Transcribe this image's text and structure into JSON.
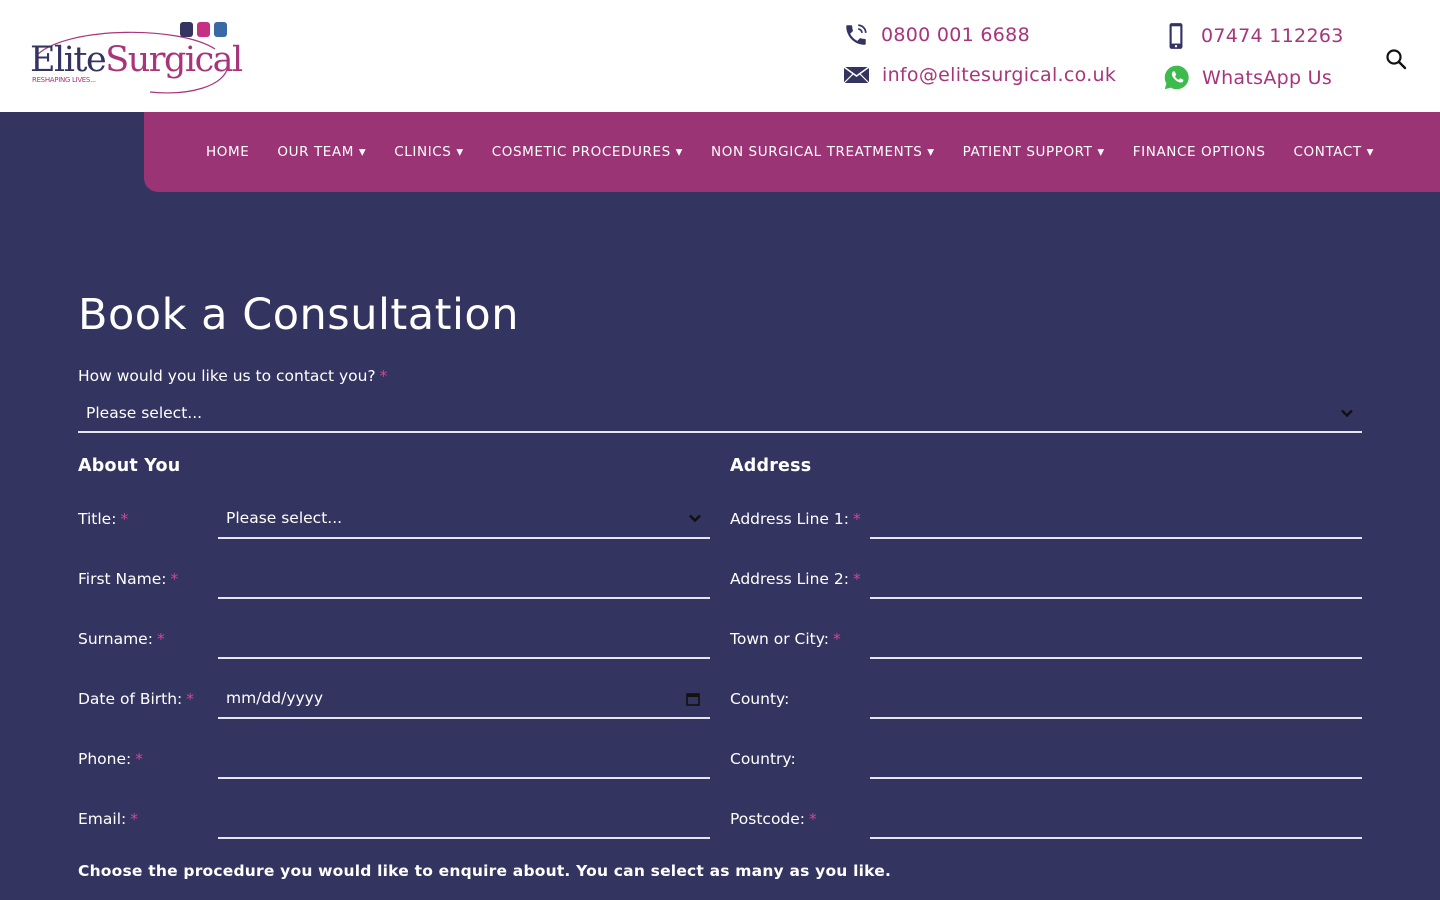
{
  "brand": {
    "name_part1": "Elite",
    "name_part2": "Surgical",
    "tagline": "RESHAPING LIVES...",
    "colors": {
      "primary": "#343461",
      "accent": "#a8357a",
      "nav": "#9b3475",
      "square1": "#343461",
      "square2": "#c63083",
      "square3": "#3a6aa6"
    }
  },
  "header": {
    "phone": "0800 001 6688",
    "mobile": "07474 112263",
    "email": "info@elitesurgical.co.uk",
    "whatsapp": "WhatsApp Us",
    "icons": {
      "phone": "phone-icon",
      "mobile": "mobile-icon",
      "email": "envelope-icon",
      "whatsapp": "whatsapp-icon",
      "search": "search-icon"
    }
  },
  "nav": {
    "items": [
      {
        "label": "HOME"
      },
      {
        "label": "OUR TEAM ▾"
      },
      {
        "label": "CLINICS ▾"
      },
      {
        "label": "COSMETIC PROCEDURES ▾"
      },
      {
        "label": "NON SURGICAL TREATMENTS ▾"
      },
      {
        "label": "PATIENT SUPPORT ▾"
      },
      {
        "label": "FINANCE OPTIONS"
      },
      {
        "label": "CONTACT ▾"
      }
    ]
  },
  "form": {
    "title": "Book a Consultation",
    "contact_question": "How would you like us to contact you?",
    "contact_value": "Please select...",
    "required_mark": "*",
    "about": {
      "heading": "About You",
      "title_label": "Title:",
      "title_value": "Please select...",
      "first_name_label": "First Name:",
      "surname_label": "Surname:",
      "dob_label": "Date of Birth:",
      "dob_placeholder": "mm/dd/yyyy",
      "phone_label": "Phone:",
      "email_label": "Email:"
    },
    "address": {
      "heading": "Address",
      "line1_label": "Address Line 1:",
      "line2_label": "Address Line 2:",
      "town_label": "Town or City:",
      "county_label": "County:",
      "country_label": "Country:",
      "postcode_label": "Postcode:"
    },
    "procedure_note": "Choose the procedure you would like to enquire about. You can select as many as you like."
  }
}
